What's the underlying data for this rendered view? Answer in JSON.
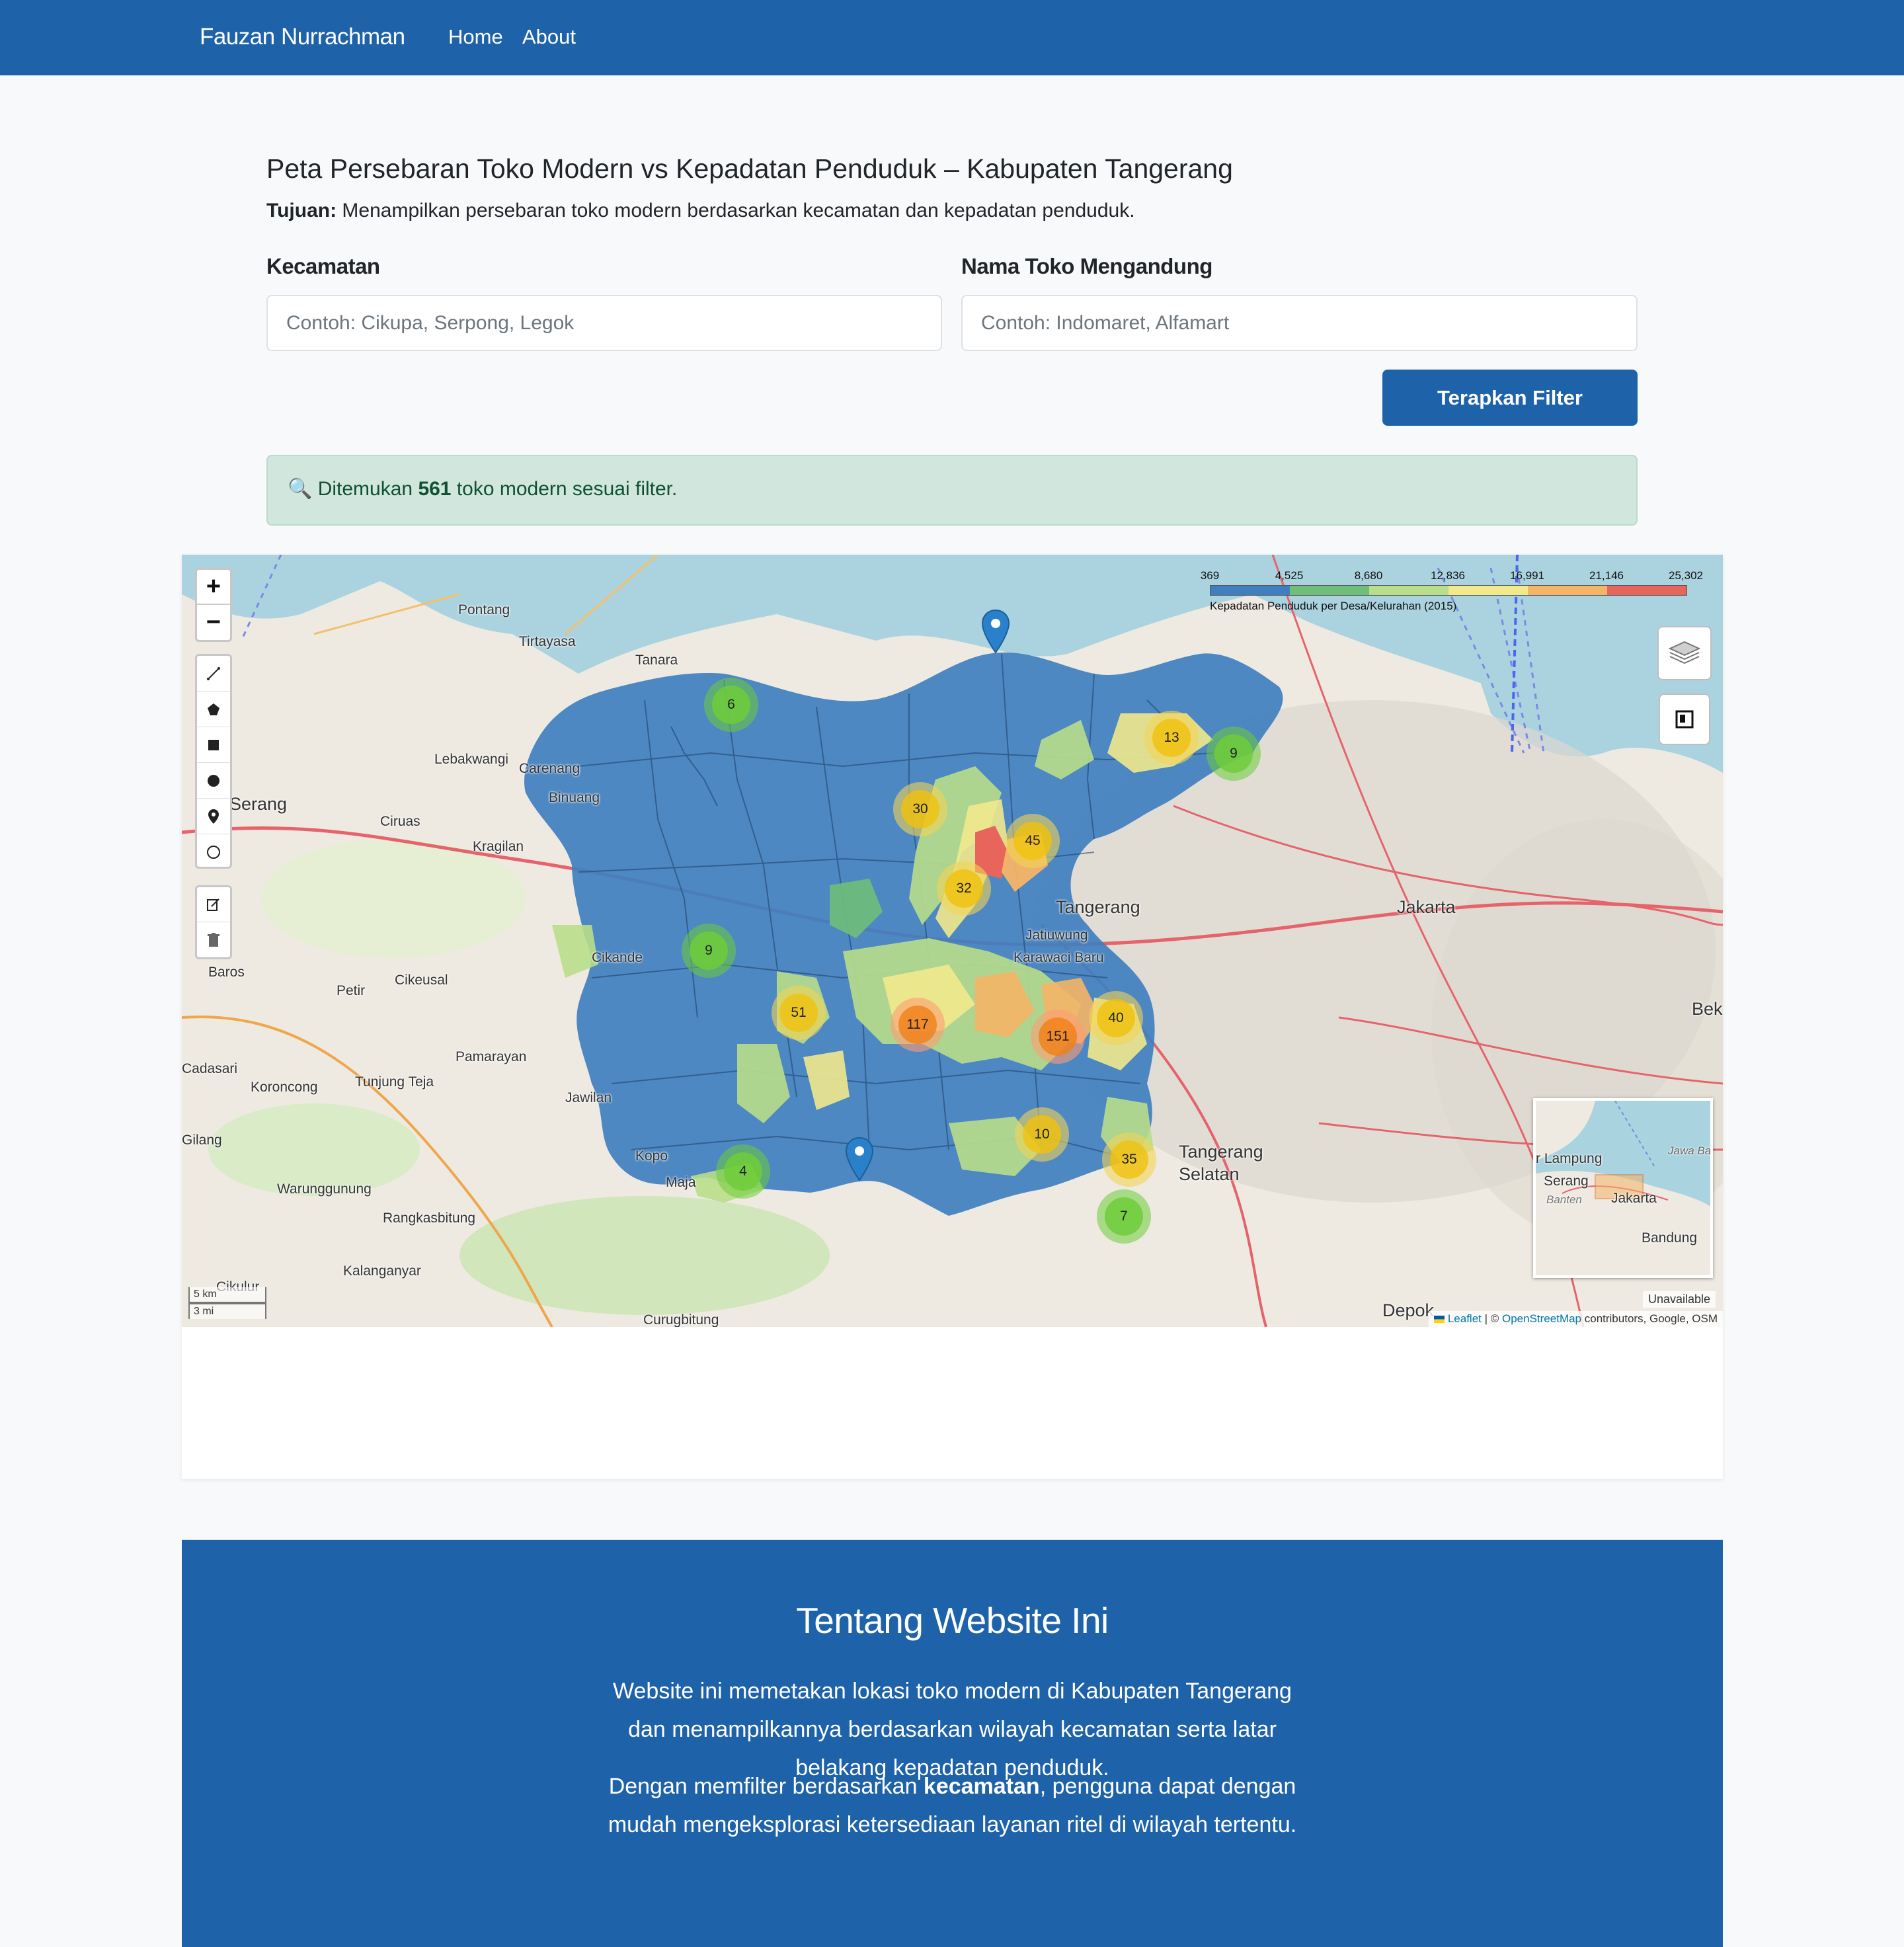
{
  "navbar": {
    "brand": "Fauzan Nurrachman",
    "links": [
      {
        "label": "Home"
      },
      {
        "label": "About"
      }
    ]
  },
  "header": {
    "title": "Peta Persebaran Toko Modern vs Kepadatan Penduduk – Kabupaten Tangerang",
    "purpose_label": "Tujuan:",
    "purpose_text": " Menampilkan persebaran toko modern berdasarkan kecamatan dan kepadatan penduduk."
  },
  "filters": {
    "kecamatan": {
      "label": "Kecamatan",
      "value": "",
      "placeholder": "Contoh: Cikupa, Serpong, Legok"
    },
    "toko": {
      "label": "Nama Toko Mengandung",
      "value": "",
      "placeholder": "Contoh: Indomaret, Alfamart"
    },
    "apply_label": "Terapkan Filter"
  },
  "result": {
    "icon": "magnifier-icon",
    "prefix": "Ditemukan ",
    "count": "561",
    "suffix": " toko modern sesuai filter."
  },
  "map": {
    "zoom_in": "+",
    "zoom_out": "−",
    "legend": {
      "ticks": [
        "369",
        "4,525",
        "8,680",
        "12,836",
        "16,991",
        "21,146",
        "25,302"
      ],
      "colors": [
        "#3f7fc0",
        "#6fbf7a",
        "#b9de8a",
        "#f1e98c",
        "#f5b567",
        "#e7655a"
      ],
      "caption": "Kepadatan Penduduk per Desa/Kelurahan (2015)"
    },
    "clusters": [
      {
        "count": "6",
        "level": "green"
      },
      {
        "count": "13",
        "level": "yellow"
      },
      {
        "count": "9",
        "level": "green"
      },
      {
        "count": "30",
        "level": "yellow"
      },
      {
        "count": "45",
        "level": "yellow"
      },
      {
        "count": "32",
        "level": "yellow"
      },
      {
        "count": "9",
        "level": "green"
      },
      {
        "count": "51",
        "level": "yellow"
      },
      {
        "count": "117",
        "level": "orange"
      },
      {
        "count": "151",
        "level": "orange"
      },
      {
        "count": "40",
        "level": "yellow"
      },
      {
        "count": "10",
        "level": "yellow"
      },
      {
        "count": "35",
        "level": "yellow"
      },
      {
        "count": "4",
        "level": "green"
      },
      {
        "count": "7",
        "level": "green"
      }
    ],
    "place_labels": [
      "Pontang",
      "Tirtayasa",
      "Tanara",
      "Lebakwangi",
      "Carenang",
      "Binuang",
      "Serang",
      "Ciruas",
      "Kragilan",
      "Cikande",
      "Baros",
      "Petir",
      "Cikeusal",
      "Pamarayan",
      "Jawilan",
      "Koroncong",
      "Tunjung Teja",
      "Cadasari",
      "Kopo",
      "Maja",
      "Warunggunung",
      "Rangkasbitung",
      "Kalanganyar",
      "Curugbitung",
      "Jatiuwung",
      "Karawaci Baru",
      "Tangerang",
      "Jakarta",
      "Tangerang Selatan",
      "Depok",
      "Bek",
      "Gilang",
      "Cikulur"
    ],
    "minimap_labels": [
      "r Lampung",
      "Serang",
      "Banten",
      "Jakarta",
      "Bandung",
      "Jawa Ba"
    ],
    "scale": [
      "5 km",
      "3 mi"
    ],
    "unavailable": "Unavailable",
    "attribution": {
      "leaflet": "Leaflet",
      "sep": " | © ",
      "osm": "OpenStreetMap",
      "rest": " contributors, Google, OSM"
    }
  },
  "about": {
    "title": "Tentang Website Ini",
    "p1": "Website ini memetakan lokasi toko modern di Kabupaten Tangerang dan menampilkannya berdasarkan wilayah kecamatan serta latar belakang kepadatan penduduk.",
    "p2_prefix": "Dengan memfilter berdasarkan ",
    "p2_bold": "kecamatan",
    "p2_suffix": ", pengguna dapat dengan mudah mengeksplorasi ketersediaan layanan ritel di wilayah tertentu."
  }
}
